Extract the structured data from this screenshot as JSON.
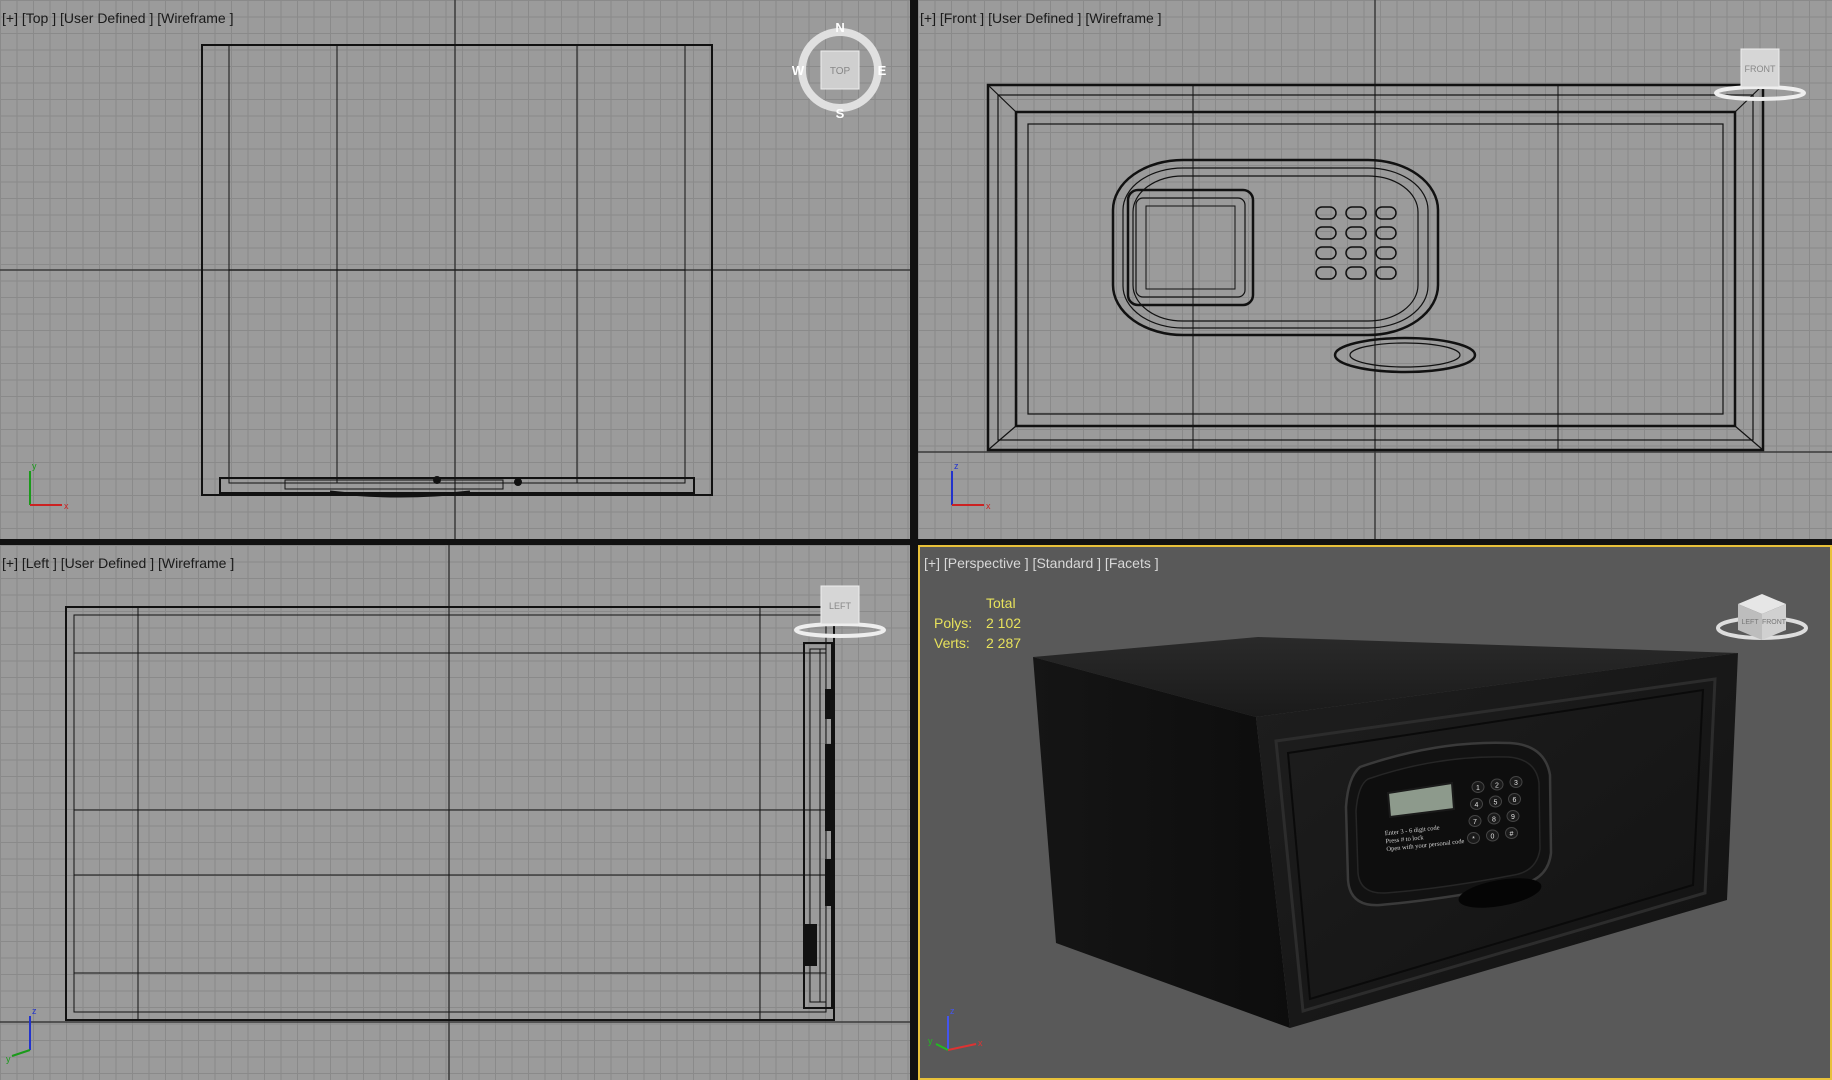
{
  "viewports": {
    "top": {
      "label": "[+] [Top ] [User Defined ] [Wireframe ]",
      "gizmo": "TOP",
      "compass": {
        "n": "N",
        "s": "S",
        "e": "E",
        "w": "W"
      }
    },
    "front": {
      "label": "[+] [Front ] [User Defined ] [Wireframe ]",
      "gizmo": "FRONT"
    },
    "left": {
      "label": "[+] [Left ] [User Defined ] [Wireframe ]",
      "gizmo": "LEFT"
    },
    "perspective": {
      "label": "[+] [Perspective ] [Standard ] [Facets ]",
      "gizmo_left": "LEFT",
      "gizmo_front": "FRONT",
      "stats": {
        "header": "Total",
        "polys_label": "Polys:",
        "polys": "2 102",
        "verts_label": "Verts:",
        "verts": "2 287"
      },
      "lcd_text": [
        "Enter 3 - 6 digit code",
        "Press # to lock",
        "Open with your personal code"
      ],
      "keypad": [
        "1",
        "2",
        "3",
        "4",
        "5",
        "6",
        "7",
        "8",
        "9",
        "*",
        "0",
        "#"
      ]
    }
  },
  "axes": {
    "x": "x",
    "y": "y",
    "z": "z"
  },
  "colors": {
    "active_border": "#e8c13a",
    "stats_text": "#e8e25c",
    "wire": "#111111",
    "grid": "#9b9b9b",
    "persp_bg": "#595959",
    "safe": "#161616"
  }
}
